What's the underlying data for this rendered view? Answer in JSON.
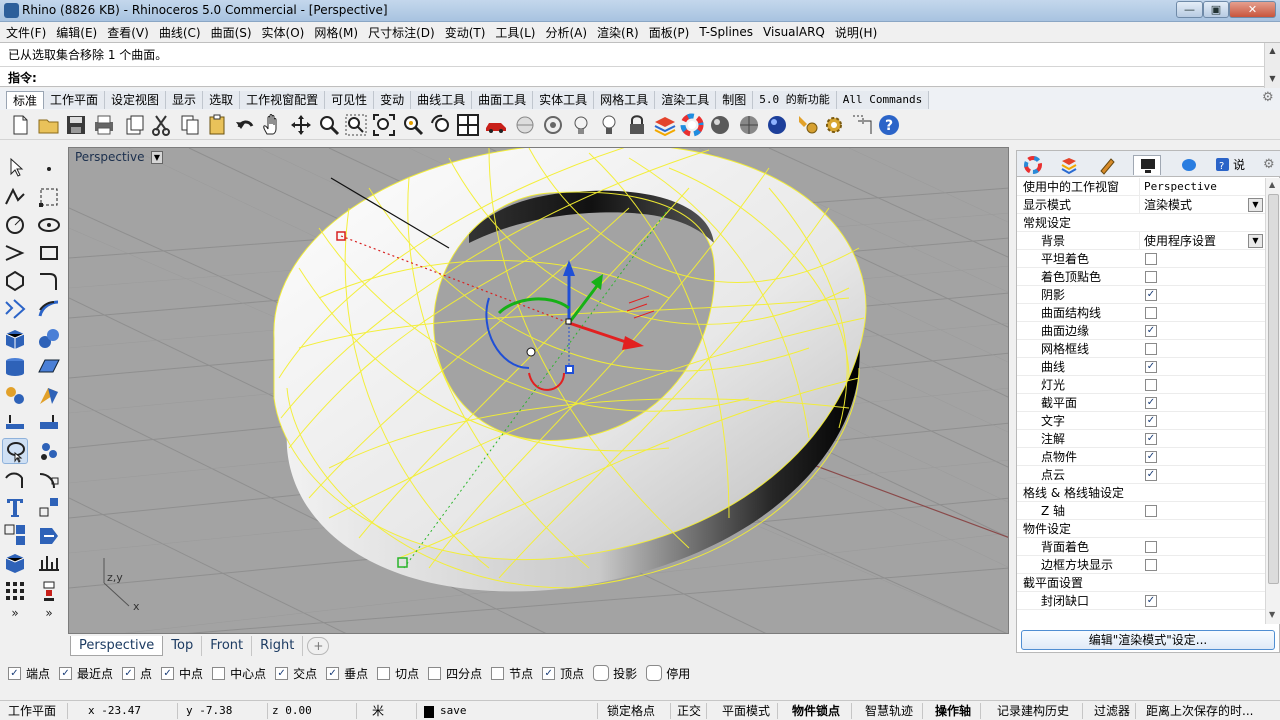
{
  "window": {
    "title": "Rhino (8826 KB) - Rhinoceros 5.0 Commercial - [Perspective]",
    "min_label": "—",
    "max_label": "▣",
    "close_label": "✕"
  },
  "menu": [
    "文件(F)",
    "编辑(E)",
    "查看(V)",
    "曲线(C)",
    "曲面(S)",
    "实体(O)",
    "网格(M)",
    "尺寸标注(D)",
    "变动(T)",
    "工具(L)",
    "分析(A)",
    "渲染(R)",
    "面板(P)",
    "T-Splines",
    "VisualARQ",
    "说明(H)"
  ],
  "command": {
    "history": "已从选取集合移除 1 个曲面。",
    "prompt": "指令:",
    "value": ""
  },
  "tabs": [
    "标准",
    "工作平面",
    "设定视图",
    "显示",
    "选取",
    "工作视窗配置",
    "可见性",
    "变动",
    "曲线工具",
    "曲面工具",
    "实体工具",
    "网格工具",
    "渲染工具",
    "制图",
    "5.0 的新功能",
    "All Commands"
  ],
  "toolbar_icons": [
    "new-file-icon",
    "open-folder-icon",
    "save-icon",
    "print-icon",
    "import-icon",
    "cut-icon",
    "copy-icon",
    "paste-icon",
    "undo-icon",
    "pan-hand-icon",
    "rotate-view-icon",
    "zoom-icon",
    "zoom-window-icon",
    "zoom-extents-icon",
    "zoom-selected-icon",
    "undo-view-icon",
    "four-viewports-icon",
    "car-icon",
    "render-preview-icon",
    "camera-icon",
    "light-bulb-icon",
    "lock-icon",
    "layers-icon",
    "color-wheel-icon",
    "material-sphere-icon",
    "shaded-sphere-icon",
    "blue-sphere-icon",
    "settings-gear-icon",
    "options-icon",
    "dimensions-icon",
    "help-icon"
  ],
  "left_tool_icons": [
    "select-arrow-icon",
    "point-icon",
    "polyline-icon",
    "rectangle-point-icon",
    "circle-icon",
    "ellipse-icon",
    "arc-icon",
    "rectangle-icon",
    "polygon-icon",
    "fillet-curve-icon",
    "freeform-curve-icon",
    "offset-icon",
    "box-icon",
    "sphere-cluster-icon",
    "cylinder-icon",
    "surface-patch-icon",
    "network-icon",
    "boolean-icon",
    "extrude-icon",
    "solid-tools-icon",
    "lasso-select-icon",
    "curve-tools-icon",
    "curve-edit-icon",
    "dimension-icon",
    "text-icon",
    "transform-icon",
    "block-icon",
    "array-icon",
    "grid-icon",
    "group-icon",
    "more-left-icon",
    "more-right-icon"
  ],
  "viewport": {
    "title": "Perspective",
    "axis_y": "z,y",
    "axis_x": "x"
  },
  "viewport_tabs": [
    "Perspective",
    "Top",
    "Front",
    "Right"
  ],
  "osnaps": [
    {
      "label": "端点",
      "checked": true
    },
    {
      "label": "最近点",
      "checked": true
    },
    {
      "label": "点",
      "checked": true
    },
    {
      "label": "中点",
      "checked": true
    },
    {
      "label": "中心点",
      "checked": false
    },
    {
      "label": "交点",
      "checked": true
    },
    {
      "label": "垂点",
      "checked": true
    },
    {
      "label": "切点",
      "checked": false
    },
    {
      "label": "四分点",
      "checked": false
    },
    {
      "label": "节点",
      "checked": false
    },
    {
      "label": "顶点",
      "checked": true
    },
    {
      "label": "投影",
      "checked": false
    },
    {
      "label": "停用",
      "checked": false
    }
  ],
  "status": {
    "cplane": "工作平面",
    "x": "x -23.47",
    "y": "y -7.38",
    "z": "z 0.00",
    "units": "米",
    "layer": "save",
    "grid_snap": "锁定格点",
    "ortho": "正交",
    "planar": "平面模式",
    "osnap": "物件锁点",
    "smarttrack": "智慧轨迹",
    "gumball": "操作轴",
    "history": "记录建构历史",
    "filter": "过滤器",
    "autosave": "距离上次保存的时..."
  },
  "panel": {
    "tab_icons": [
      "color-wheel-icon",
      "material-icon",
      "pen-icon",
      "display-icon",
      "render-sphere-icon",
      "help-panel-icon"
    ],
    "help_tab": "说",
    "rows": [
      {
        "label": "使用中的工作视窗",
        "value": "Perspective",
        "kind": "value"
      },
      {
        "label": "显示模式",
        "value": "渲染模式",
        "kind": "dropdown"
      },
      {
        "label": "常规设定",
        "kind": "section"
      },
      {
        "label": "背景",
        "value": "使用程序设置",
        "kind": "dropdown-indent"
      },
      {
        "label": "平坦着色",
        "checked": false,
        "kind": "check"
      },
      {
        "label": "着色顶點色",
        "checked": false,
        "kind": "check"
      },
      {
        "label": "阴影",
        "checked": true,
        "kind": "check"
      },
      {
        "label": "曲面结构线",
        "checked": false,
        "kind": "check"
      },
      {
        "label": "曲面边缘",
        "checked": true,
        "kind": "check"
      },
      {
        "label": "网格框线",
        "checked": false,
        "kind": "check"
      },
      {
        "label": "曲线",
        "checked": true,
        "kind": "check"
      },
      {
        "label": "灯光",
        "checked": false,
        "kind": "check"
      },
      {
        "label": "截平面",
        "checked": true,
        "kind": "check"
      },
      {
        "label": "文字",
        "checked": true,
        "kind": "check"
      },
      {
        "label": "注解",
        "checked": true,
        "kind": "check"
      },
      {
        "label": "点物件",
        "checked": true,
        "kind": "check"
      },
      {
        "label": "点云",
        "checked": true,
        "kind": "check"
      },
      {
        "label": "格线 & 格线轴设定",
        "kind": "section"
      },
      {
        "label": "Z 轴",
        "checked": false,
        "kind": "check"
      },
      {
        "label": "物件设定",
        "kind": "section"
      },
      {
        "label": "背面着色",
        "checked": false,
        "kind": "check"
      },
      {
        "label": "边框方块显示",
        "checked": false,
        "kind": "check"
      },
      {
        "label": "截平面设置",
        "kind": "section"
      },
      {
        "label": "封闭缺口",
        "checked": true,
        "kind": "check"
      }
    ],
    "edit_button": "编辑\"渲染模式\"设定..."
  }
}
